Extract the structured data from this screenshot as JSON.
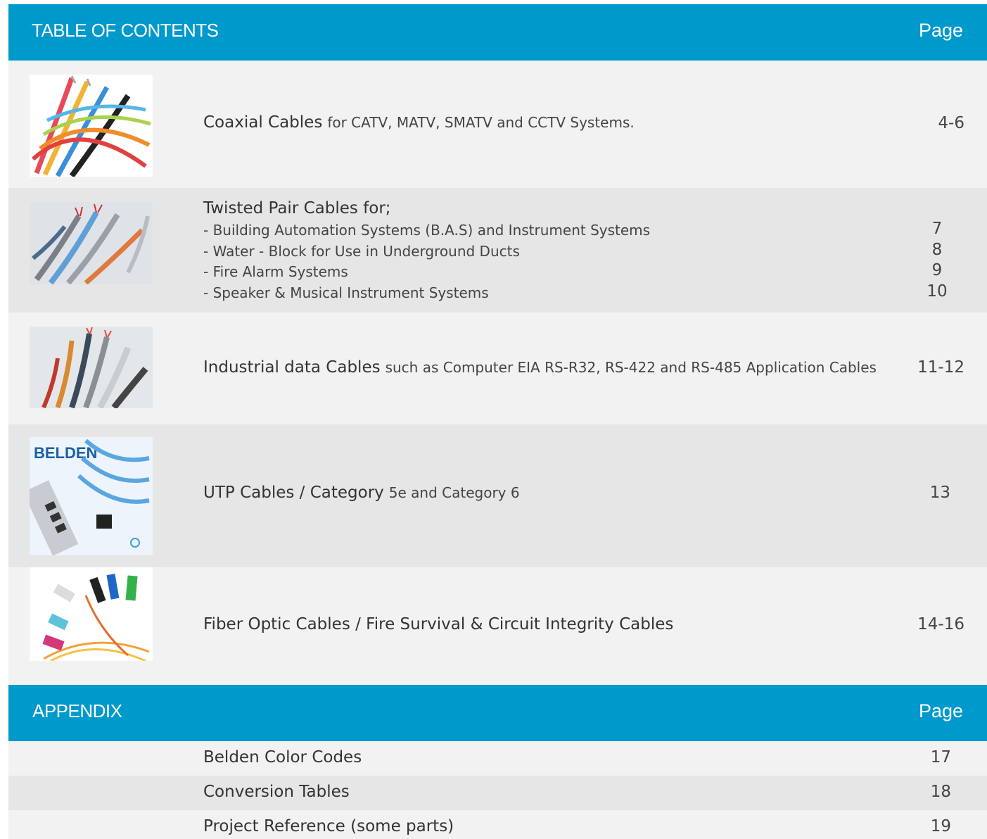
{
  "toc_header": {
    "title": "TABLE OF CONTENTS",
    "page_label": "Page"
  },
  "sections": {
    "coaxial": {
      "main": "Coaxial Cables",
      "sub": "for CATV, MATV, SMATV and CCTV Systems.",
      "page": "4-6",
      "thumb_icon": "coaxial-cables-photo"
    },
    "twisted": {
      "title": "Twisted Pair Cables for;",
      "items": [
        {
          "label": "- Building Automation Systems (B.A.S) and Instrument Systems",
          "page": "7"
        },
        {
          "label": "- Water - Block for Use in Underground Ducts",
          "page": "8"
        },
        {
          "label": "- Fire Alarm Systems",
          "page": "9"
        },
        {
          "label": "- Speaker & Musical Instrument Systems",
          "page": "10"
        }
      ],
      "thumb_icon": "twisted-pair-cables-photo"
    },
    "industrial": {
      "main": "Industrial data Cables",
      "sub": "such as Computer EIA RS-R32, RS-422 and RS-485 Application Cables",
      "page": "11-12",
      "thumb_icon": "industrial-cables-photo"
    },
    "utp": {
      "main": "UTP Cables / Category",
      "sub": "5e and Category 6",
      "page": "13",
      "thumb_icon": "belden-utp-photo",
      "brand": "BELDEN"
    },
    "fiber": {
      "main": "Fiber Optic Cables / Fire Survival & Circuit Integrity Cables",
      "page": "14-16",
      "thumb_icon": "fiber-optic-connectors-photo"
    }
  },
  "appendix_header": {
    "title": "APPENDIX",
    "page_label": "Page"
  },
  "appendix": [
    {
      "label": "Belden Color Codes",
      "page": "17"
    },
    {
      "label": "Conversion Tables",
      "page": "18"
    },
    {
      "label": "Project Reference (some parts)",
      "page": "19"
    }
  ],
  "colors": {
    "header": "#0099cc",
    "row_light": "#f2f2f2",
    "row_dark": "#e6e6e6"
  }
}
